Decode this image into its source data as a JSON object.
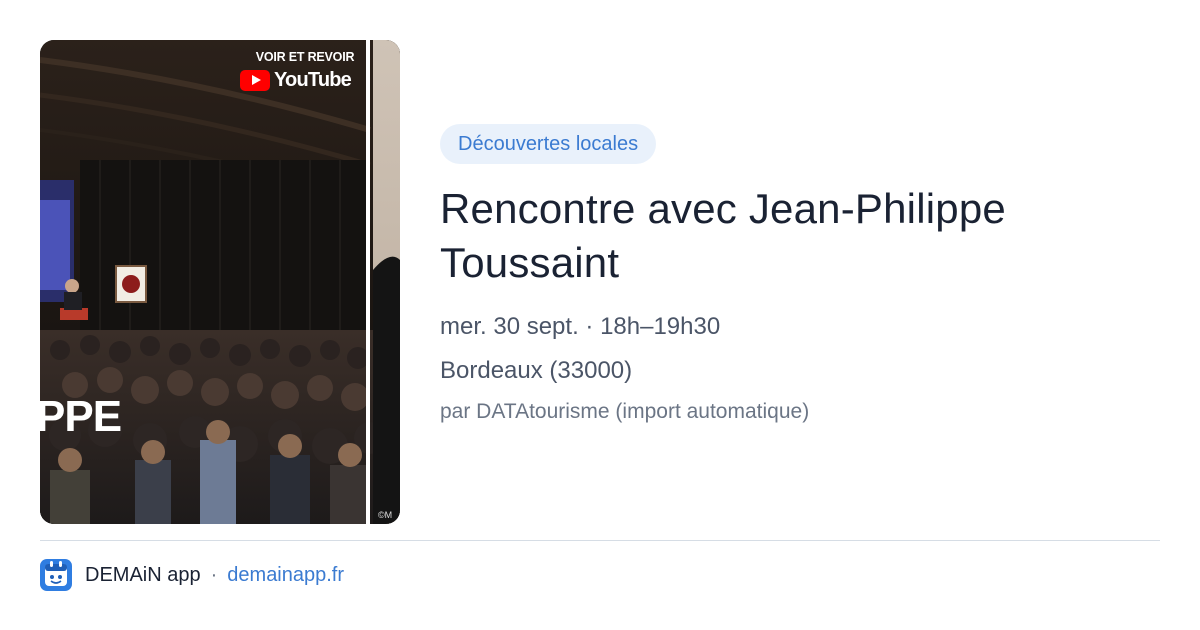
{
  "image": {
    "overlay_label": "VOIR ET REVOIR",
    "platform_label": "YouTube",
    "banner_text": "PPE",
    "copyright": "©M"
  },
  "event": {
    "category": "Découvertes locales",
    "title": "Rencontre avec Jean-Philippe Toussaint",
    "date_time": "mer. 30 sept. · 18h–19h30",
    "location": "Bordeaux (33000)",
    "source": "par DATAtourisme (import automatique)"
  },
  "footer": {
    "app_icon": "demain-app-icon",
    "app_name": "DEMAiN app",
    "separator": "·",
    "link": "demainapp.fr"
  },
  "colors": {
    "accent": "#3b7bd1",
    "badge_bg": "#e9f1fb",
    "title": "#1a2233",
    "muted": "#4b5567",
    "youtube_red": "#ff0000"
  }
}
